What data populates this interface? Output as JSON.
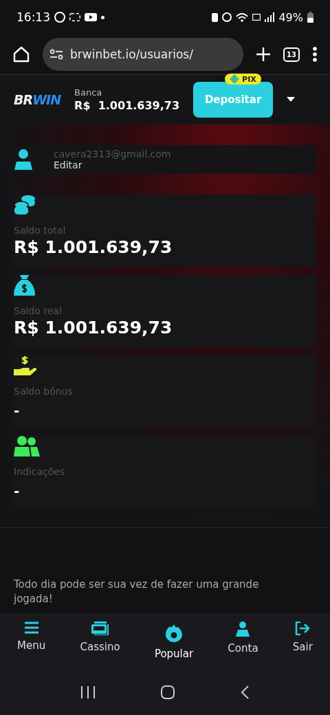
{
  "status_bar": {
    "time": "16:13",
    "battery": "49%"
  },
  "browser": {
    "url": "brwinbet.io/usuarios/",
    "tab_count": "13"
  },
  "header": {
    "logo": [
      "BR",
      "WIN"
    ],
    "balance_label": "Banca",
    "balance": "R$  1.001.639,73",
    "deposit_button": "Depositar",
    "pix_badge": "PIX"
  },
  "profile": {
    "email": "cavera2313@gmail.com",
    "edit_link": "Editar"
  },
  "cards": [
    {
      "kind": "coins",
      "label": "Saldo total",
      "value": "R$ 1.001.639,73"
    },
    {
      "kind": "bag",
      "label": "Saldo real",
      "value": "R$ 1.001.639,73"
    },
    {
      "kind": "hand",
      "label": "Saldo bônus",
      "value": "-"
    },
    {
      "kind": "people",
      "label": "Indicações",
      "value": "-"
    }
  ],
  "footer_text": "Todo dia pode ser sua vez de fazer uma grande jogada!",
  "bottom_nav": [
    {
      "kind": "menu",
      "label": "Menu",
      "selected": false
    },
    {
      "kind": "slots",
      "label": "Cassino",
      "selected": false
    },
    {
      "kind": "fire",
      "label": "Popular",
      "selected": true
    },
    {
      "kind": "person",
      "label": "Conta",
      "selected": false
    },
    {
      "kind": "logout",
      "label": "Sair",
      "selected": false
    }
  ]
}
